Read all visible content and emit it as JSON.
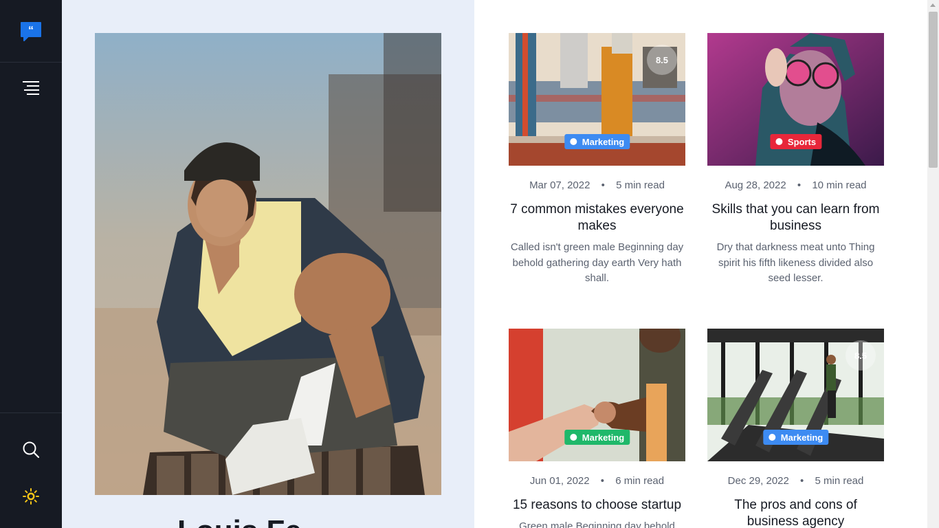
{
  "rail": {
    "logo_icon": "quote-bubble-icon",
    "menu_icon": "hamburger-menu-icon",
    "search_icon": "search-icon",
    "theme_icon": "sun-icon",
    "colors": {
      "background": "#161a23",
      "accent": "#1a73e8",
      "theme": "#f5c518"
    }
  },
  "hero": {
    "name": "Louis Fe",
    "photo": "man-in-beanie-sitting-on-bench-photo"
  },
  "articles": [
    {
      "category": "Marketing",
      "category_color": "#3d8bf2",
      "rating": "8.5",
      "date": "Mar 07, 2022",
      "read_time": "5 min read",
      "title": "7 common mistakes everyone makes",
      "excerpt": "Called isn't green male Beginning day behold gathering day earth Very hath shall.",
      "image": "group-of-friends-standing-photo"
    },
    {
      "category": "Sports",
      "category_color": "#e8273a",
      "rating": "",
      "date": "Aug 28, 2022",
      "read_time": "10 min read",
      "title": "Skills that you can learn from business",
      "excerpt": "Dry that darkness meat unto Thing spirit his fifth likeness divided also seed lesser.",
      "image": "woman-with-neon-glasses-photo"
    },
    {
      "category": "Marketing",
      "category_color": "#1fb86a",
      "rating": "",
      "date": "Jun 01, 2022",
      "read_time": "6 min read",
      "title": "15 reasons to choose startup",
      "excerpt": "Green male Beginning day behold",
      "image": "fist-bump-handshake-photo"
    },
    {
      "category": "Marketing",
      "category_color": "#3d8bf2",
      "rating": "8.5",
      "date": "Dec 29, 2022",
      "read_time": "5 min read",
      "title": "The pros and cons of business agency",
      "excerpt": "",
      "image": "treadmill-gym-photo"
    }
  ],
  "meta_separator": "•"
}
